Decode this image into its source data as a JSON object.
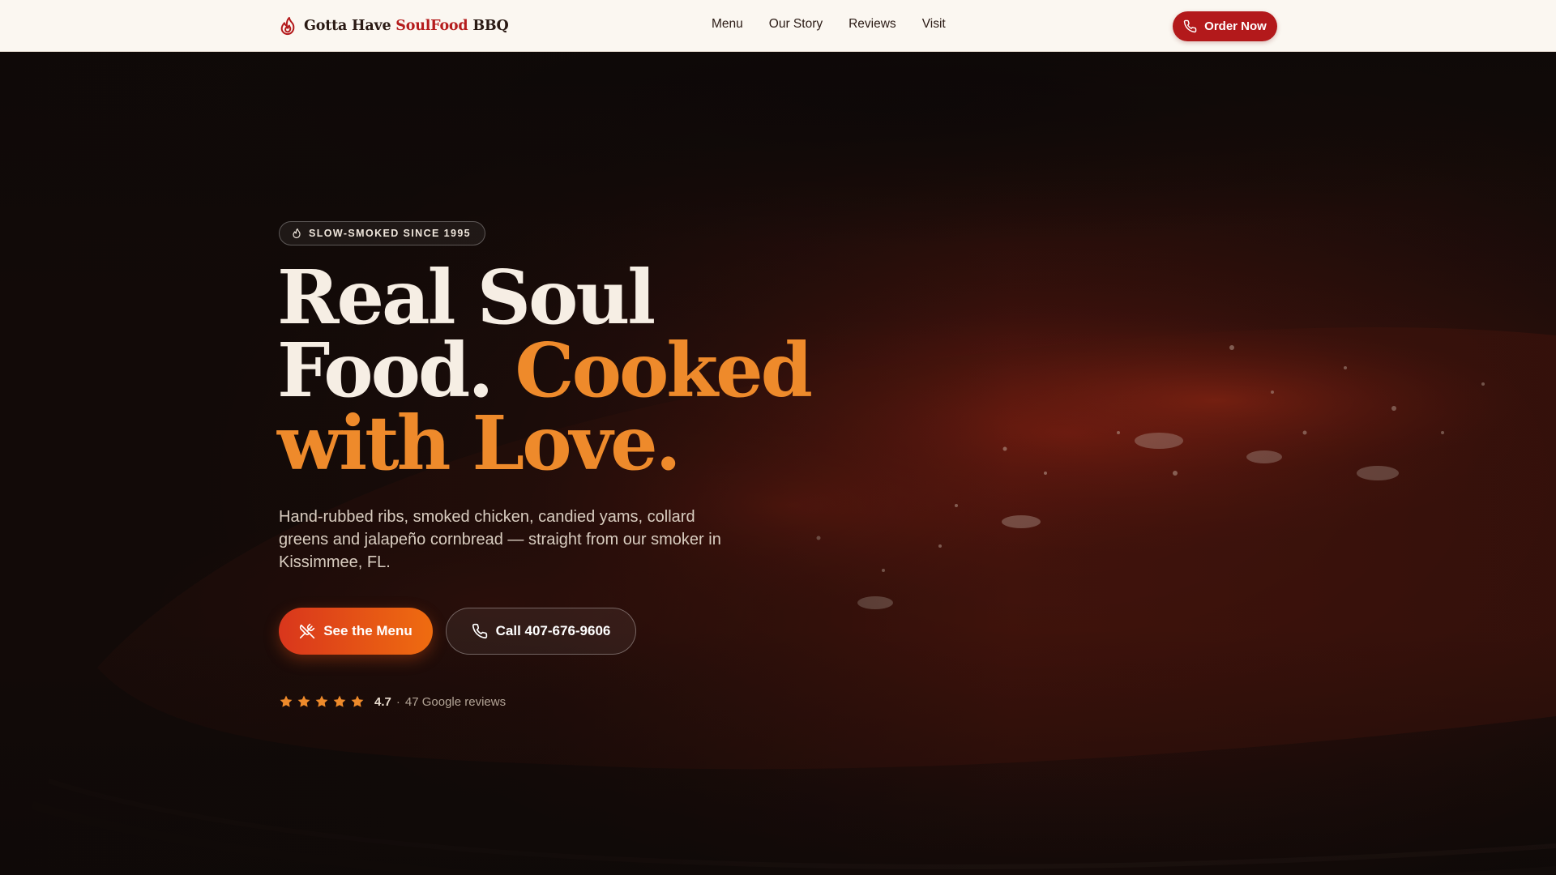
{
  "nav": {
    "brand": {
      "part1": "Gotta Have ",
      "part2": "SoulFood",
      "part3": " BBQ"
    },
    "links": [
      "Menu",
      "Our Story",
      "Reviews",
      "Visit"
    ],
    "order_label": "Order Now"
  },
  "hero": {
    "badge": "SLOW-SMOKED SINCE 1995",
    "headline": {
      "line1": "Real Soul",
      "line2_white": "Food. ",
      "line2_orange": "Cooked",
      "line3": "with Love."
    },
    "subcopy": "Hand-rubbed ribs, smoked chicken, candied yams, collard greens and jalapeño cornbread — straight from our smoker in Kissimmee, FL.",
    "primary_button": "See the Menu",
    "secondary_button": "Call 407-676-9606",
    "rating": {
      "value": "4.7",
      "separator": "·",
      "count_text": "47 Google reviews",
      "stars": 5
    }
  },
  "colors": {
    "brand_red": "#b3191b",
    "accent_orange": "#ee8a2b",
    "nav_bg": "#fbf7f1",
    "hero_bg": "#120b09"
  },
  "icons": {
    "brand": "flame-icon",
    "order": "phone-icon",
    "badge": "flame-icon",
    "menu_button": "utensils-crossed-icon",
    "call_button": "phone-icon",
    "rating": "star-icon"
  }
}
